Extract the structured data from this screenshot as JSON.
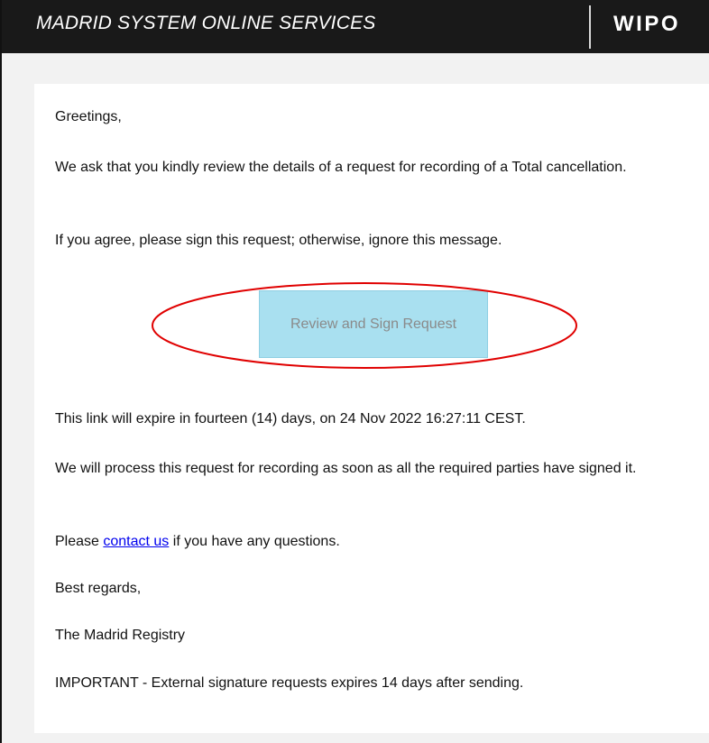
{
  "header": {
    "title": "MADRID SYSTEM ONLINE SERVICES",
    "logo": "WIPO"
  },
  "email": {
    "greeting": "Greetings,",
    "request_text": "We ask that you kindly review the details of a request for recording of a Total cancellation.",
    "agree_text": "If you agree, please sign this request; otherwise, ignore this message.",
    "cta_label": "Review and Sign Request",
    "expiry_text": "This link will expire in fourteen (14) days, on 24 Nov 2022 16:27:11 CEST.",
    "process_text": "We will process this request for recording as soon as all the required parties have signed it.",
    "contact_prefix": "Please ",
    "contact_link": "contact us",
    "contact_suffix": " if you have any questions.",
    "closing": "Best regards,",
    "signature": "The Madrid Registry",
    "important": "IMPORTANT - External signature requests expires 14 days after sending."
  },
  "colors": {
    "header_bg": "#191919",
    "cta_bg": "#a9e0f0",
    "highlight_ring": "#e00000",
    "link": "#0000ee"
  }
}
